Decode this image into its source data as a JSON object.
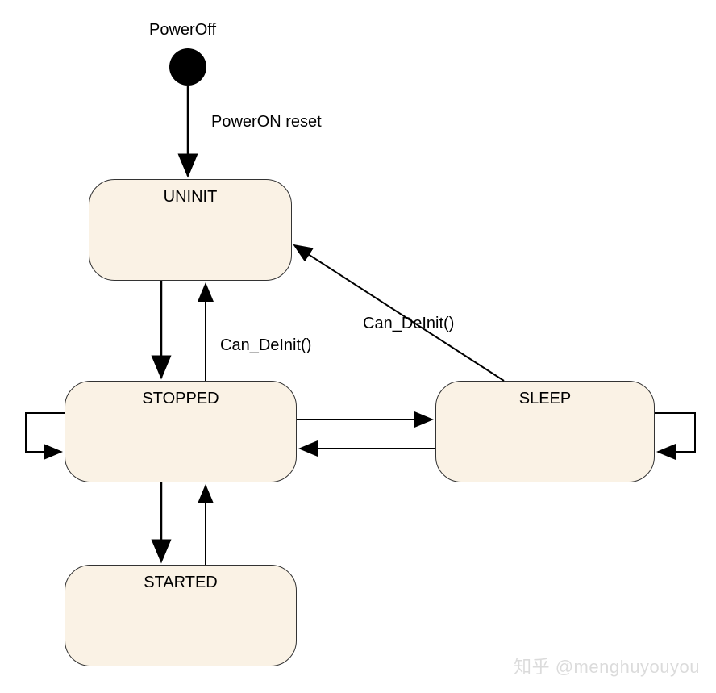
{
  "initial_state_label": "PowerOff",
  "states": {
    "uninit": "UNINIT",
    "stopped": "STOPPED",
    "sleep": "SLEEP",
    "started": "STARTED"
  },
  "transitions": {
    "power_on": "PowerON reset",
    "deinit_stopped_to_uninit": "Can_DeInit()",
    "deinit_sleep_to_uninit": "Can_DeInit()"
  },
  "watermark": "知乎 @menghuyouyou",
  "chart_data": {
    "type": "state-machine",
    "initial": "PowerOff",
    "states": [
      "UNINIT",
      "STOPPED",
      "SLEEP",
      "STARTED"
    ],
    "transitions": [
      {
        "from": "PowerOff",
        "to": "UNINIT",
        "label": "PowerON reset"
      },
      {
        "from": "UNINIT",
        "to": "STOPPED",
        "label": ""
      },
      {
        "from": "STOPPED",
        "to": "UNINIT",
        "label": "Can_DeInit()"
      },
      {
        "from": "STOPPED",
        "to": "SLEEP",
        "label": ""
      },
      {
        "from": "SLEEP",
        "to": "STOPPED",
        "label": ""
      },
      {
        "from": "SLEEP",
        "to": "UNINIT",
        "label": "Can_DeInit()"
      },
      {
        "from": "STOPPED",
        "to": "STARTED",
        "label": ""
      },
      {
        "from": "STARTED",
        "to": "STOPPED",
        "label": ""
      },
      {
        "from": "STOPPED",
        "to": "STOPPED",
        "label": ""
      },
      {
        "from": "SLEEP",
        "to": "SLEEP",
        "label": ""
      }
    ]
  }
}
